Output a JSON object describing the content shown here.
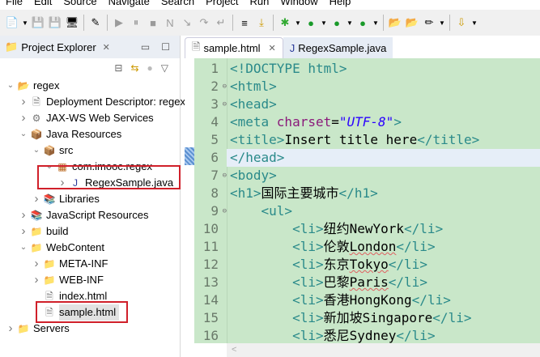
{
  "menu": [
    "File",
    "Edit",
    "Source",
    "Navigate",
    "Search",
    "Project",
    "Run",
    "Window",
    "Help"
  ],
  "explorer": {
    "title": "Project Explorer",
    "items": [
      {
        "label": "regex",
        "depth": 0,
        "twisty": "open",
        "icon": "project-icon"
      },
      {
        "label": "Deployment Descriptor: regex",
        "depth": 1,
        "twisty": "closed",
        "icon": "deployment-icon"
      },
      {
        "label": "JAX-WS Web Services",
        "depth": 1,
        "twisty": "closed",
        "icon": "webservice-icon"
      },
      {
        "label": "Java Resources",
        "depth": 1,
        "twisty": "open",
        "icon": "java-resources-icon"
      },
      {
        "label": "src",
        "depth": 2,
        "twisty": "open",
        "icon": "source-folder-icon"
      },
      {
        "label": "com.imooc.regex",
        "depth": 3,
        "twisty": "open",
        "icon": "package-icon"
      },
      {
        "label": "RegexSample.java",
        "depth": 4,
        "twisty": "closed",
        "icon": "java-file-icon"
      },
      {
        "label": "Libraries",
        "depth": 2,
        "twisty": "closed",
        "icon": "libraries-icon"
      },
      {
        "label": "JavaScript Resources",
        "depth": 1,
        "twisty": "closed",
        "icon": "libraries-icon"
      },
      {
        "label": "build",
        "depth": 1,
        "twisty": "closed",
        "icon": "folder-icon"
      },
      {
        "label": "WebContent",
        "depth": 1,
        "twisty": "open",
        "icon": "folder-icon"
      },
      {
        "label": "META-INF",
        "depth": 2,
        "twisty": "closed",
        "icon": "folder-icon"
      },
      {
        "label": "WEB-INF",
        "depth": 2,
        "twisty": "closed",
        "icon": "folder-icon"
      },
      {
        "label": "index.html",
        "depth": 2,
        "twisty": "none",
        "icon": "html-file-icon"
      },
      {
        "label": "sample.html",
        "depth": 2,
        "twisty": "none",
        "icon": "html-file-icon",
        "selected": true
      },
      {
        "label": "Servers",
        "depth": 0,
        "twisty": "closed",
        "icon": "servers-folder-icon"
      }
    ]
  },
  "tabs": [
    {
      "label": "sample.html",
      "active": true
    },
    {
      "label": "RegexSample.java",
      "active": false
    }
  ],
  "code": [
    {
      "n": "1",
      "seg": [
        [
          "t",
          "<!DOCTYPE html>"
        ]
      ]
    },
    {
      "n": "2",
      "fold": true,
      "seg": [
        [
          "t",
          "<html>"
        ]
      ]
    },
    {
      "n": "3",
      "fold": true,
      "seg": [
        [
          "t",
          "<head>"
        ]
      ]
    },
    {
      "n": "4",
      "seg": [
        [
          "t",
          "<meta "
        ],
        [
          "a",
          "charset"
        ],
        [
          "x",
          "="
        ],
        [
          "s",
          "\"UTF-8\""
        ],
        [
          "t",
          ">"
        ]
      ]
    },
    {
      "n": "5",
      "seg": [
        [
          "t",
          "<title>"
        ],
        [
          "x",
          "Insert title here"
        ],
        [
          "t",
          "</title>"
        ]
      ]
    },
    {
      "n": "6",
      "cur": true,
      "seg": [
        [
          "t",
          "</head>"
        ]
      ]
    },
    {
      "n": "7",
      "fold": true,
      "seg": [
        [
          "t",
          "<body>"
        ]
      ]
    },
    {
      "n": "8",
      "seg": [
        [
          "t",
          "<h1>"
        ],
        [
          "x",
          "国际主要城市"
        ],
        [
          "t",
          "</h1>"
        ]
      ]
    },
    {
      "n": "9",
      "fold": true,
      "seg": [
        [
          "x",
          "    "
        ],
        [
          "t",
          "<ul>"
        ]
      ]
    },
    {
      "n": "10",
      "seg": [
        [
          "x",
          "        "
        ],
        [
          "t",
          "<li>"
        ],
        [
          "x",
          "纽约NewYork"
        ],
        [
          "t",
          "</li>"
        ]
      ]
    },
    {
      "n": "11",
      "seg": [
        [
          "x",
          "        "
        ],
        [
          "t",
          "<li>"
        ],
        [
          "x",
          "伦敦"
        ],
        [
          "xsq",
          "London"
        ],
        [
          "t",
          "</li>"
        ]
      ]
    },
    {
      "n": "12",
      "seg": [
        [
          "x",
          "        "
        ],
        [
          "t",
          "<li>"
        ],
        [
          "x",
          "东京"
        ],
        [
          "xsq",
          "Tokyo"
        ],
        [
          "t",
          "</li>"
        ]
      ]
    },
    {
      "n": "13",
      "seg": [
        [
          "x",
          "        "
        ],
        [
          "t",
          "<li>"
        ],
        [
          "x",
          "巴黎"
        ],
        [
          "xsq",
          "Paris"
        ],
        [
          "t",
          "</li>"
        ]
      ]
    },
    {
      "n": "14",
      "seg": [
        [
          "x",
          "        "
        ],
        [
          "t",
          "<li>"
        ],
        [
          "x",
          "香港HongKong"
        ],
        [
          "t",
          "</li>"
        ]
      ]
    },
    {
      "n": "15",
      "seg": [
        [
          "x",
          "        "
        ],
        [
          "t",
          "<li>"
        ],
        [
          "x",
          "新加坡Singapore"
        ],
        [
          "t",
          "</li>"
        ]
      ]
    },
    {
      "n": "16",
      "seg": [
        [
          "x",
          "        "
        ],
        [
          "t",
          "<li>"
        ],
        [
          "x",
          "悉尼Sydney"
        ],
        [
          "t",
          "</li>"
        ]
      ]
    }
  ],
  "hscroll_arrow": "<"
}
